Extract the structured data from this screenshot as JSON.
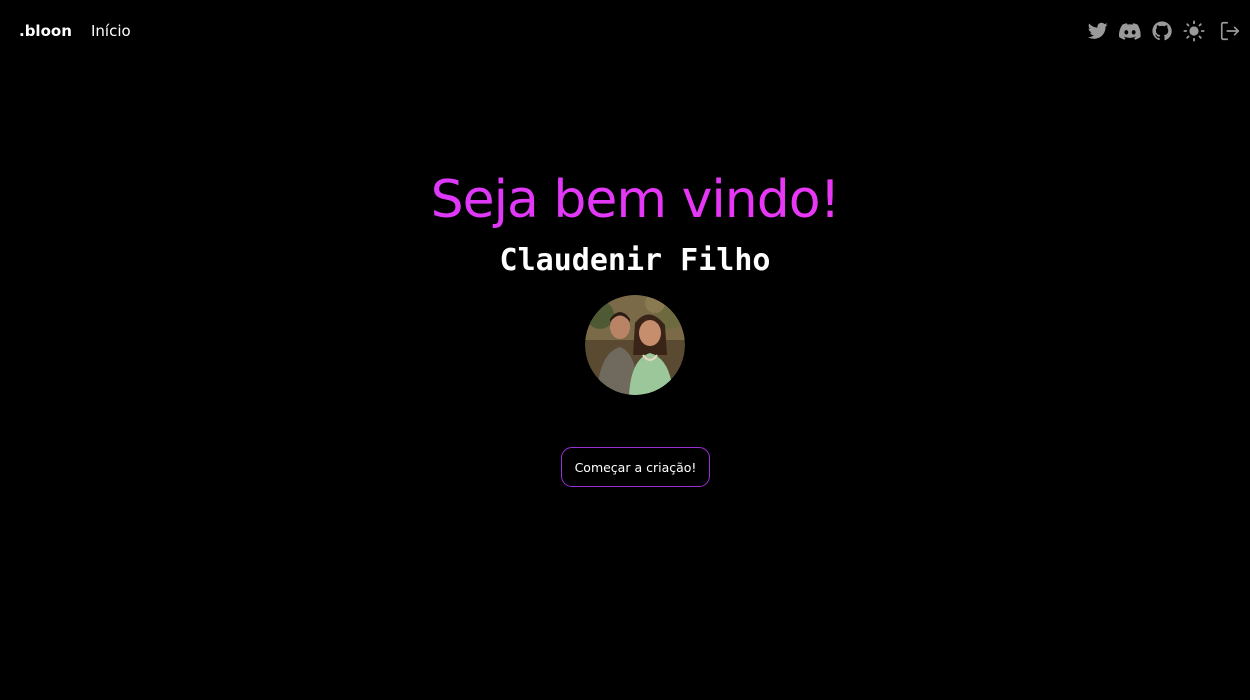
{
  "header": {
    "brand": ".bloon",
    "nav": [
      {
        "label": "Início"
      }
    ],
    "icons": [
      "twitter-icon",
      "discord-icon",
      "github-icon",
      "sun-icon",
      "logout-icon"
    ]
  },
  "hero": {
    "title": "Seja bem vindo!",
    "user_name": "Claudenir Filho",
    "cta_label": "Começar a criação!"
  },
  "colors": {
    "background": "#000000",
    "title_gradient_start": "#d13bff",
    "title_gradient_end": "#ee3af0",
    "cta_border": "#9b2fd6",
    "icon": "#9a9a9a"
  }
}
